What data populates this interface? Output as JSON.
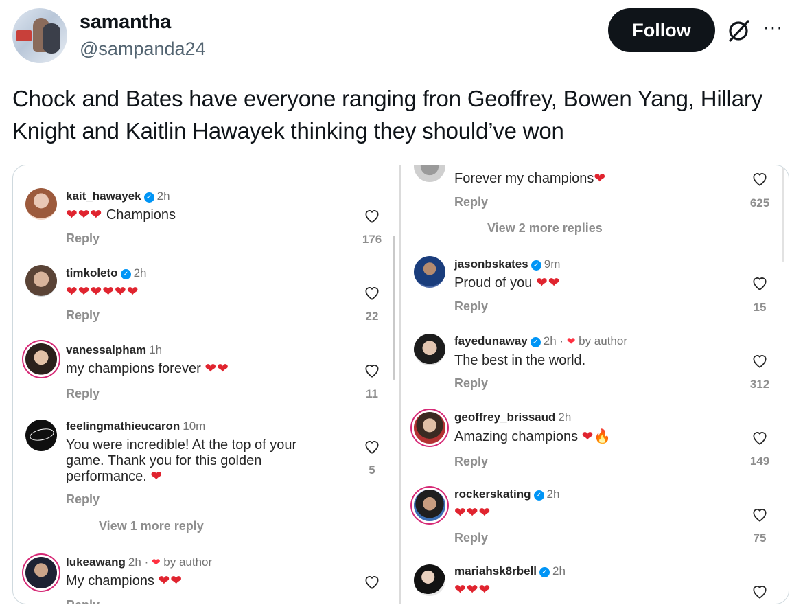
{
  "tweet": {
    "author_name": "samantha",
    "author_handle": "@sampanda24",
    "follow_label": "Follow",
    "more_label": "···",
    "text": "Chock and Bates have everyone ranging fron Geoffrey, Bowen Yang, Hillary Knight and Kaitlin Hawayek thinking they should’ve won"
  },
  "left_comments": [
    {
      "user": "kait_hawayek",
      "verified": "✓",
      "time": "2h",
      "text": "❤️❤️❤️ Champions",
      "hearts": "❤❤❤",
      "body": "Champions",
      "reply": "Reply",
      "likes": "176"
    },
    {
      "user": "timkoleto",
      "verified": "✓",
      "time": "2h",
      "hearts": "❤❤❤❤❤❤",
      "reply": "Reply",
      "likes": "22"
    },
    {
      "user": "vanessalpham",
      "time": "1h",
      "body": "my champions forever",
      "hearts": "❤❤",
      "reply": "Reply",
      "likes": "11"
    },
    {
      "user": "feelingmathieucaron",
      "time": "10m",
      "line1": "You were incredible! At the top of your",
      "line2": "game. Thank you for this golden",
      "line3": "performance.",
      "hearts": "❤",
      "reply": "Reply",
      "likes": "5",
      "view_more": "View 1 more reply"
    },
    {
      "user": "lukeawang",
      "time": "2h",
      "by_author": "by author",
      "body": "My champions",
      "hearts": "❤❤",
      "reply": "Reply"
    }
  ],
  "right_comments": [
    {
      "body": "Forever my champions",
      "hearts": "❤",
      "reply": "Reply",
      "likes": "625",
      "view_more": "View 2 more replies"
    },
    {
      "user": "jasonbskates",
      "verified": "✓",
      "time": "9m",
      "body": "Proud of you",
      "hearts": "❤❤",
      "reply": "Reply",
      "likes": "15"
    },
    {
      "user": "fayedunaway",
      "verified": "✓",
      "time": "2h",
      "by_author": "by author",
      "body": "The best in the world.",
      "reply": "Reply",
      "likes": "312"
    },
    {
      "user": "geoffrey_brissaud",
      "time": "2h",
      "body": "Amazing champions",
      "hearts": "❤",
      "fire": "🔥",
      "reply": "Reply",
      "likes": "149"
    },
    {
      "user": "rockerskating",
      "verified": "✓",
      "time": "2h",
      "hearts": "❤❤❤",
      "reply": "Reply",
      "likes": "75"
    },
    {
      "user": "mariahsk8rbell",
      "verified": "✓",
      "time": "2h",
      "hearts": "❤❤❤"
    }
  ],
  "icons": {
    "like": "heart-outline-icon",
    "grok": "grok-icon",
    "verified": "verified-badge-icon"
  },
  "colors": {
    "follow_bg": "#0f1419",
    "heart": "#e0242f",
    "verified": "#0095f6",
    "muted": "#8e8e8e"
  }
}
